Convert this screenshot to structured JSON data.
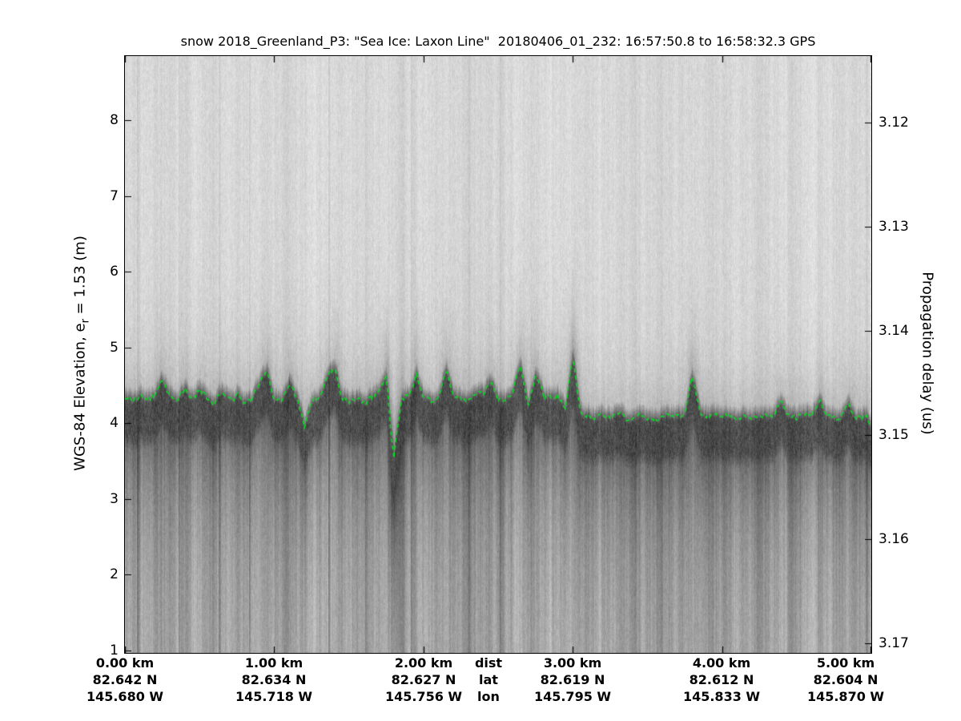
{
  "title": "snow 2018_Greenland_P3: \"Sea Ice: Laxon Line\"  20180406_01_232: 16:57:50.8 to 16:58:32.3 GPS",
  "left_axis": {
    "label_prefix": "WGS-84 Elevation, e",
    "label_sub": "r",
    "label_suffix": " = 1.53 (m)",
    "ticks": [
      "8",
      "7",
      "6",
      "5",
      "4",
      "3",
      "2",
      "1"
    ]
  },
  "right_axis": {
    "label": "Propagation delay (us)",
    "ticks": [
      "3.12",
      "3.13",
      "3.14",
      "3.15",
      "3.16",
      "3.17"
    ]
  },
  "bottom_axis": {
    "headers": {
      "dist": "dist",
      "lat": "lat",
      "lon": "lon"
    },
    "columns": [
      {
        "dist": "0.00 km",
        "lat": "82.642 N",
        "lon": "145.680 W"
      },
      {
        "dist": "1.00 km",
        "lat": "82.634 N",
        "lon": "145.718 W"
      },
      {
        "dist": "2.00 km",
        "lat": "82.627 N",
        "lon": "145.756 W"
      },
      {
        "dist": "3.00 km",
        "lat": "82.619 N",
        "lon": "145.795 W"
      },
      {
        "dist": "4.00 km",
        "lat": "82.612 N",
        "lon": "145.833 W"
      },
      {
        "dist": "5.00 km",
        "lat": "82.604 N",
        "lon": "145.870 W"
      }
    ]
  },
  "chart_data": {
    "type": "heatmap",
    "title": "snow 2018_Greenland_P3: \"Sea Ice: Laxon Line\"  20180406_01_232: 16:57:50.8 to 16:58:32.3 GPS",
    "description": "Snow radar echogram of sea ice along the Laxon Line; grayscale backscatter vs distance and WGS-84 elevation with tracked surface pick overlaid in green.",
    "xlabel_rows": [
      "dist",
      "lat",
      "lon"
    ],
    "x_range_km": [
      0,
      5
    ],
    "x_ticks_km": [
      0,
      1,
      2,
      3,
      4,
      5
    ],
    "x_tick_labels": [
      "0.00 km",
      "1.00 km",
      "2.00 km",
      "3.00 km",
      "4.00 km",
      "5.00 km"
    ],
    "lat_labels": [
      "82.642 N",
      "82.634 N",
      "82.627 N",
      "82.619 N",
      "82.612 N",
      "82.604 N"
    ],
    "lon_labels": [
      "145.680 W",
      "145.718 W",
      "145.756 W",
      "145.795 W",
      "145.833 W",
      "145.870 W"
    ],
    "ylabel_left": "WGS-84 Elevation, e_r = 1.53 (m)",
    "ylabel_right": "Propagation delay (us)",
    "left_ticks_m": [
      8,
      7,
      6,
      5,
      4,
      3,
      2,
      1
    ],
    "right_ticks_us": [
      3.12,
      3.13,
      3.14,
      3.15,
      3.16,
      3.17
    ],
    "ylim_elevation_m": [
      0.97,
      8.85
    ],
    "surface_band": {
      "mean_elevation_left_half_m": 4.33,
      "mean_elevation_right_half_m": 4.08,
      "band_thickness_m": 0.45
    },
    "surface_profile": {
      "x_km": [
        0.0,
        0.05,
        0.1,
        0.15,
        0.2,
        0.25,
        0.3,
        0.35,
        0.4,
        0.45,
        0.5,
        0.55,
        0.6,
        0.65,
        0.7,
        0.75,
        0.8,
        0.85,
        0.9,
        0.95,
        1.0,
        1.05,
        1.1,
        1.15,
        1.2,
        1.25,
        1.3,
        1.35,
        1.4,
        1.45,
        1.5,
        1.55,
        1.6,
        1.65,
        1.7,
        1.75,
        1.8,
        1.85,
        1.9,
        1.95,
        2.0,
        2.05,
        2.1,
        2.15,
        2.2,
        2.25,
        2.3,
        2.35,
        2.4,
        2.45,
        2.5,
        2.55,
        2.6,
        2.65,
        2.7,
        2.75,
        2.8,
        2.85,
        2.9,
        2.95,
        3.0,
        3.05,
        3.1,
        3.15,
        3.2,
        3.25,
        3.3,
        3.35,
        3.4,
        3.45,
        3.5,
        3.55,
        3.6,
        3.65,
        3.7,
        3.75,
        3.8,
        3.85,
        3.9,
        3.95,
        4.0,
        4.05,
        4.1,
        4.15,
        4.2,
        4.25,
        4.3,
        4.35,
        4.4,
        4.45,
        4.5,
        4.55,
        4.6,
        4.65,
        4.7,
        4.75,
        4.8,
        4.85,
        4.9,
        4.95,
        5.0
      ],
      "elevation_m": [
        4.33,
        4.3,
        4.36,
        4.3,
        4.34,
        4.6,
        4.36,
        4.3,
        4.42,
        4.32,
        4.47,
        4.3,
        4.28,
        4.42,
        4.32,
        4.35,
        4.3,
        4.28,
        4.52,
        4.68,
        4.32,
        4.26,
        4.55,
        4.32,
        3.96,
        4.32,
        4.33,
        4.58,
        4.76,
        4.36,
        4.3,
        4.33,
        4.28,
        4.32,
        4.42,
        4.62,
        3.52,
        4.3,
        4.36,
        4.64,
        4.31,
        4.28,
        4.36,
        4.7,
        4.36,
        4.31,
        4.29,
        4.42,
        4.36,
        4.56,
        4.33,
        4.31,
        4.47,
        4.76,
        4.22,
        4.62,
        4.38,
        4.32,
        4.35,
        4.2,
        4.9,
        4.12,
        4.08,
        4.06,
        4.11,
        4.08,
        4.13,
        4.08,
        4.06,
        4.11,
        4.08,
        4.05,
        4.1,
        4.08,
        4.13,
        4.1,
        4.65,
        4.13,
        4.08,
        4.11,
        4.06,
        4.13,
        4.08,
        4.11,
        4.05,
        4.1,
        4.08,
        4.13,
        4.3,
        4.1,
        4.07,
        4.12,
        4.1,
        4.33,
        4.1,
        4.07,
        4.12,
        4.28,
        4.04,
        4.1,
        3.97
      ]
    },
    "colors": {
      "surface_line": "#00e41e",
      "frame": "#000000",
      "background": "#ffffff",
      "speckle_light": "#d8d8d8",
      "band_dark": "#4a4a4a",
      "below_mean": "#a8a8a8"
    },
    "legend": "none",
    "grid": false
  }
}
